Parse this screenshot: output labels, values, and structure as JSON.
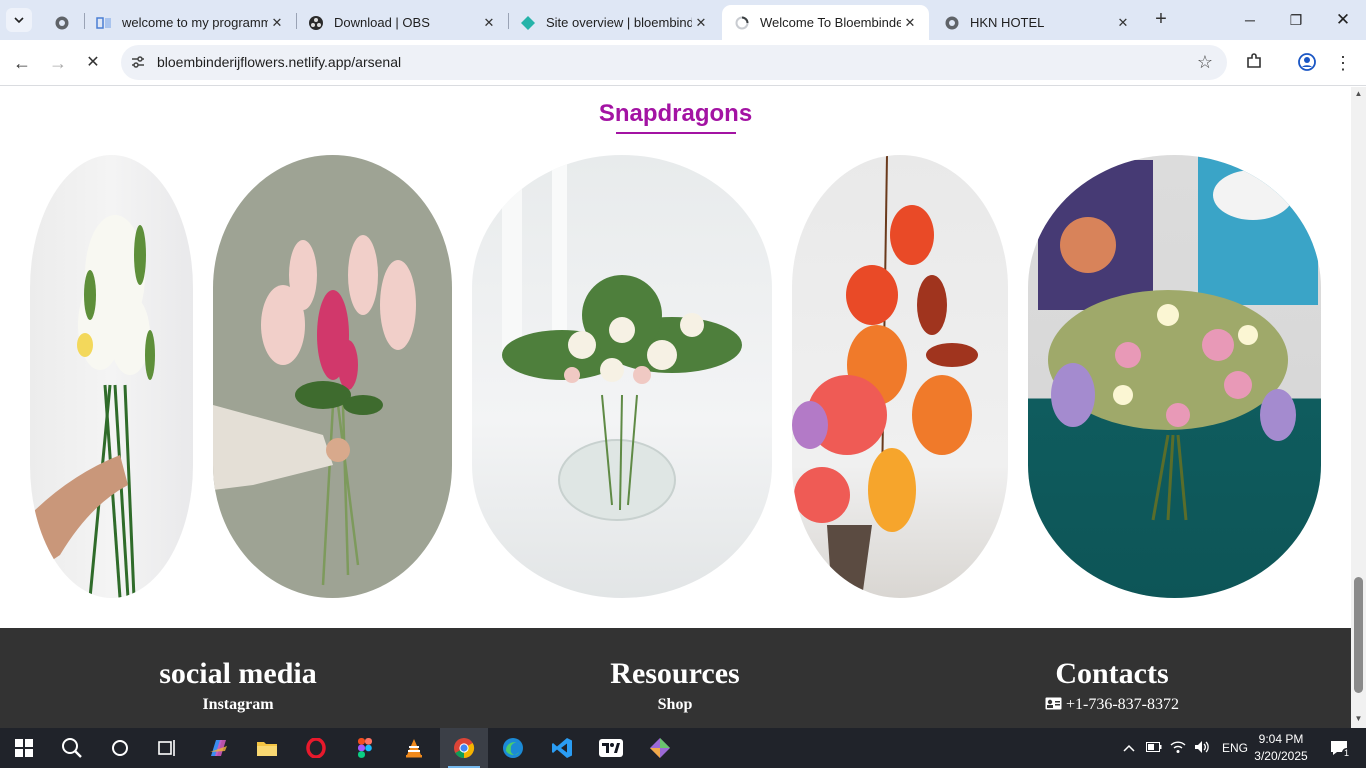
{
  "browser": {
    "tabs": [
      {
        "title": "welcome to my programm",
        "favicon": "file-doc-icon",
        "active": false
      },
      {
        "title": "Download | OBS",
        "favicon": "obs-icon",
        "active": false
      },
      {
        "title": "Site overview | bloembinde",
        "favicon": "netlify-icon",
        "active": false
      },
      {
        "title": "Welcome To Bloembinderij",
        "favicon": "loading-icon",
        "active": true
      },
      {
        "title": "HKN HOTEL",
        "favicon": "globe-icon",
        "active": false
      }
    ],
    "url": "bloembinderijflowers.netlify.app/arsenal"
  },
  "page": {
    "section_title": "Snapdragons",
    "images": [
      {
        "name": "white-snapdragon-bouquet-in-hand"
      },
      {
        "name": "pink-snapdragon-bouquet-in-hand"
      },
      {
        "name": "white-flowers-in-glass-vase"
      },
      {
        "name": "red-orange-tulip-rose-arrangement"
      },
      {
        "name": "mixed-bouquet-on-teal-table"
      }
    ],
    "footer": {
      "social_title": "social media",
      "social_link": "Instagram",
      "resources_title": "Resources",
      "resources_link": "Shop",
      "contacts_title": "Contacts",
      "phone": "+1-736-837-8372"
    }
  },
  "taskbar": {
    "language": "ENG",
    "time": "9:04 PM",
    "date": "3/20/2025",
    "notification_count": "1"
  },
  "colors": {
    "accent": "#a313a3",
    "footer_bg": "#333333",
    "taskbar_bg": "#20232a"
  }
}
